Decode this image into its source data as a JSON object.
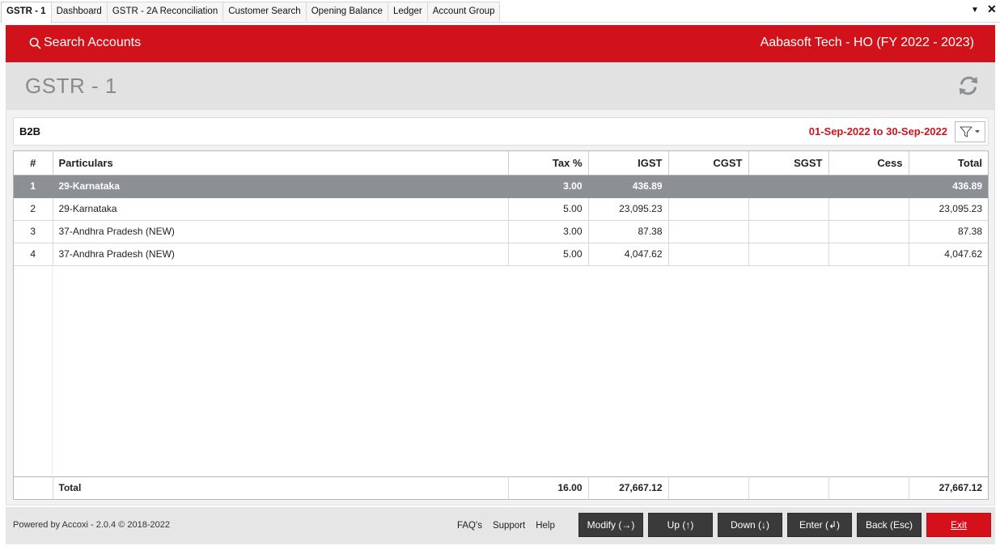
{
  "tabs": [
    {
      "label": "GSTR - 1",
      "active": true
    },
    {
      "label": "Dashboard",
      "active": false
    },
    {
      "label": "GSTR - 2A Reconciliation",
      "active": false
    },
    {
      "label": "Customer Search",
      "active": false
    },
    {
      "label": "Opening Balance",
      "active": false
    },
    {
      "label": "Ledger",
      "active": false
    },
    {
      "label": "Account Group",
      "active": false
    }
  ],
  "window": {
    "dropdown_glyph": "▼",
    "close_glyph": "✕"
  },
  "header": {
    "search_label": "Search Accounts",
    "company": "Aabasoft Tech - HO (FY 2022 - 2023)",
    "accent_color": "#d1121a"
  },
  "page": {
    "title": "GSTR - 1"
  },
  "section": {
    "title": "B2B",
    "date_range": "01-Sep-2022 to 30-Sep-2022"
  },
  "table": {
    "columns": [
      "#",
      "Particulars",
      "Tax %",
      "IGST",
      "CGST",
      "SGST",
      "Cess",
      "Total"
    ],
    "rows": [
      {
        "no": "1",
        "particulars": "29-Karnataka",
        "tax": "3.00",
        "igst": "436.89",
        "cgst": "",
        "sgst": "",
        "cess": "",
        "total": "436.89",
        "selected": true
      },
      {
        "no": "2",
        "particulars": "29-Karnataka",
        "tax": "5.00",
        "igst": "23,095.23",
        "cgst": "",
        "sgst": "",
        "cess": "",
        "total": "23,095.23",
        "selected": false
      },
      {
        "no": "3",
        "particulars": "37-Andhra Pradesh (NEW)",
        "tax": "3.00",
        "igst": "87.38",
        "cgst": "",
        "sgst": "",
        "cess": "",
        "total": "87.38",
        "selected": false
      },
      {
        "no": "4",
        "particulars": "37-Andhra Pradesh (NEW)",
        "tax": "5.00",
        "igst": "4,047.62",
        "cgst": "",
        "sgst": "",
        "cess": "",
        "total": "4,047.62",
        "selected": false
      }
    ],
    "totals": {
      "label": "Total",
      "tax": "16.00",
      "igst": "27,667.12",
      "cgst": "",
      "sgst": "",
      "cess": "",
      "total": "27,667.12"
    }
  },
  "footer": {
    "powered": "Powered by Accoxi - 2.0.4 © 2018-2022",
    "links": [
      "FAQ's",
      "Support",
      "Help"
    ],
    "buttons": {
      "modify": "Modify (→)",
      "up": "Up (↑)",
      "down": "Down (↓)",
      "enter": "Enter (↲)",
      "back": "Back (Esc)",
      "exit": "Exit"
    }
  }
}
